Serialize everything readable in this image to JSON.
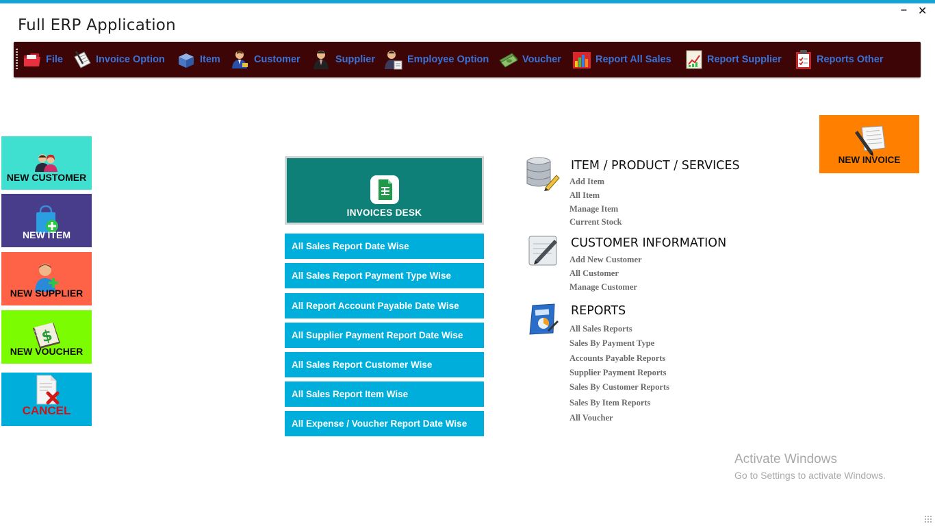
{
  "window": {
    "title": "Full ERP Application",
    "minimize": "–",
    "close": "✕"
  },
  "menu": [
    {
      "label": "File",
      "icon": "folder-icon"
    },
    {
      "label": "Invoice Option",
      "icon": "invoice-icon"
    },
    {
      "label": "Item",
      "icon": "box-icon"
    },
    {
      "label": "Customer",
      "icon": "customer-icon"
    },
    {
      "label": "Supplier",
      "icon": "supplier-icon"
    },
    {
      "label": "Employee Option",
      "icon": "employee-icon"
    },
    {
      "label": "Voucher",
      "icon": "voucher-icon"
    },
    {
      "label": "Report All Sales",
      "icon": "sales-chart-icon"
    },
    {
      "label": "Report Supplier",
      "icon": "supplier-report-icon"
    },
    {
      "label": "Reports Other",
      "icon": "clipboard-icon"
    }
  ],
  "tiles": [
    {
      "label": "NEW CUSTOMER",
      "color": "#40e0d0"
    },
    {
      "label": "NEW ITEM",
      "color": "#483d8b"
    },
    {
      "label": "NEW SUPPLIER",
      "color": "#ff6347"
    },
    {
      "label": "NEW VOUCHER",
      "color": "#7cfc00"
    },
    {
      "label": "CANCEL",
      "color": "#00aedb"
    }
  ],
  "invoices_desk": {
    "label": "INVOICES  DESK"
  },
  "report_buttons": [
    "All Sales Report Date Wise",
    "All Sales Report Payment Type Wise",
    "All Report Account Payable Date Wise",
    "All Supplier Payment Report Date Wise",
    "All Sales Report Customer Wise",
    "All Sales Report Item Wise",
    "All Expense / Voucher Report Date Wise"
  ],
  "sections": [
    {
      "title": "ITEM / PRODUCT / SERVICES",
      "links": [
        "Add Item",
        "All Item",
        "Manage Item",
        "Current Stock"
      ]
    },
    {
      "title": "CUSTOMER INFORMATION",
      "links": [
        "Add New Customer",
        "All Customer",
        "Manage Customer"
      ]
    },
    {
      "title": "REPORTS",
      "links": [
        "All Sales Reports",
        "Sales By Payment Type",
        "Accounts Payable Reports",
        "Supplier Payment Reports",
        "Sales By Customer Reports",
        "Sales By Item Reports",
        "All Voucher"
      ]
    }
  ],
  "new_invoice": {
    "label": "NEW INVOICE",
    "color": "#ff7f00"
  },
  "watermark": {
    "title": "Activate Windows",
    "subtitle": "Go to Settings to activate Windows."
  }
}
